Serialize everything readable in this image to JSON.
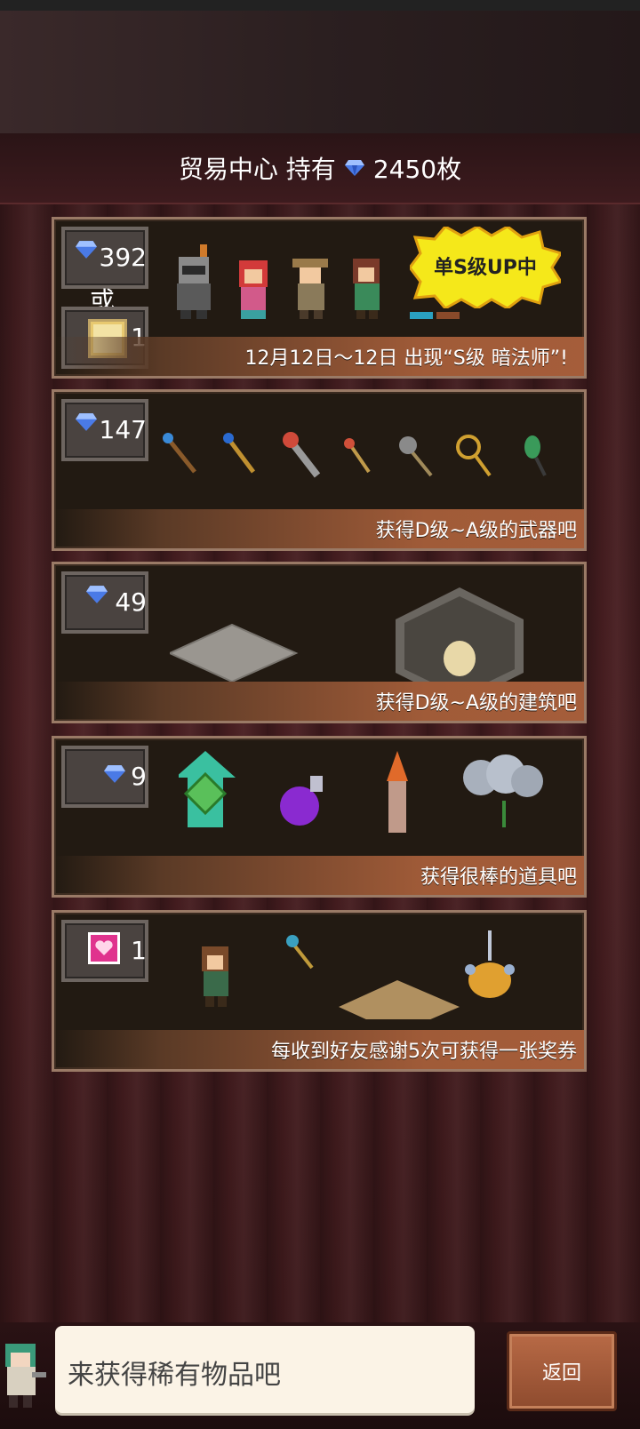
{
  "header": {
    "title": "贸易中心 持有",
    "gems_owned": "2450枚",
    "gem_icon": "blue-gem-icon"
  },
  "panels": [
    {
      "cost_gems": "392",
      "or_text": "或",
      "cost_ticket": "1",
      "badge": "单S级UP中",
      "caption": "12月12日～12日 出现“S级 暗法师”!"
    },
    {
      "cost_gems": "147",
      "caption": "获得D级~A级的武器吧"
    },
    {
      "cost_gems": "49",
      "caption": "获得D级~A级的建筑吧"
    },
    {
      "cost_gems": "9",
      "caption": "获得很棒的道具吧"
    },
    {
      "cost_hearts": "1",
      "caption": "每收到好友感谢5次可获得一张奖券"
    }
  ],
  "footer": {
    "speech": "来获得稀有物品吧",
    "back_label": "返回"
  },
  "colors": {
    "accent_strip": "#a55d3a",
    "badge_yellow": "#f5e81a",
    "heart_pink": "#e0338e",
    "gem_blue": "#3a6ad8"
  }
}
